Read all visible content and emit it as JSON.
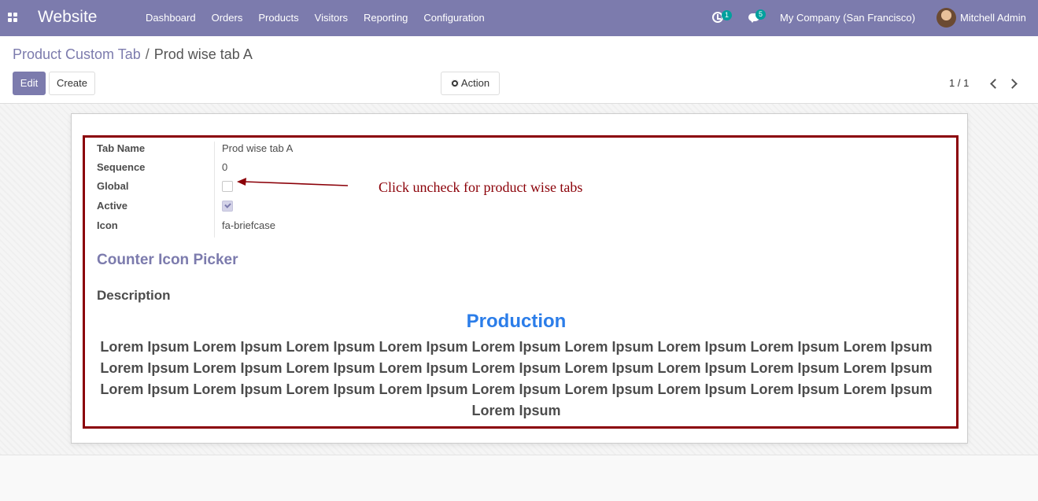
{
  "navbar": {
    "brand": "Website",
    "menu": [
      "Dashboard",
      "Orders",
      "Products",
      "Visitors",
      "Reporting",
      "Configuration"
    ],
    "activity_count": "1",
    "message_count": "5",
    "company": "My Company (San Francisco)",
    "user": "Mitchell Admin",
    "bg_color": "#7c7bad"
  },
  "breadcrumb": {
    "parent": "Product Custom Tab",
    "separator": "/",
    "current": "Prod wise tab A"
  },
  "buttons": {
    "edit": "Edit",
    "create": "Create",
    "action": "Action"
  },
  "pager": {
    "value": "1 / 1"
  },
  "form": {
    "fields": {
      "tab_name": {
        "label": "Tab Name",
        "value": "Prod wise tab A"
      },
      "sequence": {
        "label": "Sequence",
        "value": "0"
      },
      "global": {
        "label": "Global",
        "checked": false
      },
      "active": {
        "label": "Active",
        "checked": true
      },
      "icon": {
        "label": "Icon",
        "value": "fa-briefcase"
      }
    },
    "annotation": "Click uncheck for product wise tabs",
    "section_title": "Counter Icon Picker",
    "description_label": "Description",
    "description_heading": "Production",
    "description_body": "Lorem Ipsum Lorem Ipsum Lorem Ipsum Lorem Ipsum Lorem Ipsum Lorem Ipsum Lorem Ipsum Lorem Ipsum Lorem Ipsum Lorem Ipsum Lorem Ipsum Lorem Ipsum Lorem Ipsum Lorem Ipsum Lorem Ipsum Lorem Ipsum Lorem Ipsum Lorem Ipsum Lorem Ipsum Lorem Ipsum Lorem Ipsum Lorem Ipsum Lorem Ipsum Lorem Ipsum Lorem Ipsum Lorem Ipsum Lorem Ipsum Lorem Ipsum"
  },
  "colors": {
    "highlight_border": "#8b0008",
    "heading_blue": "#2b7de9"
  }
}
